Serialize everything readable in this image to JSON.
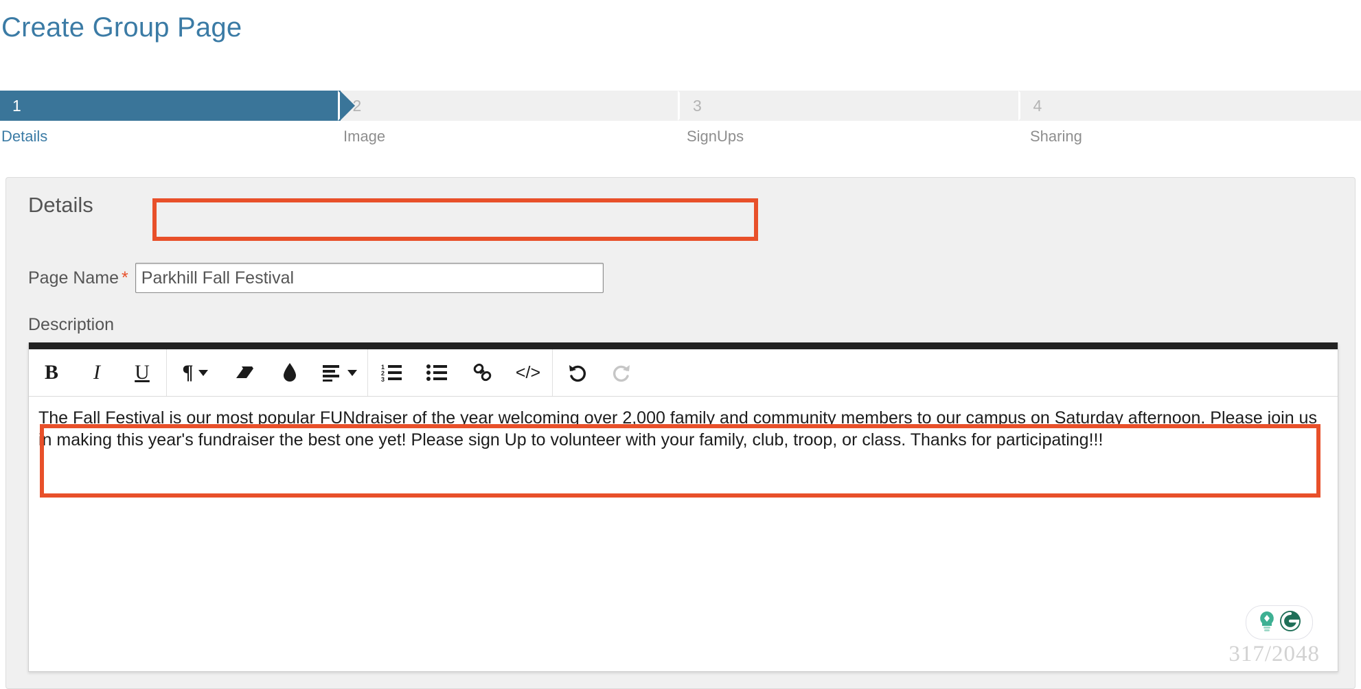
{
  "page": {
    "title": "Create Group Page"
  },
  "wizard": {
    "steps": [
      {
        "number": "1",
        "label": "Details",
        "state": "active"
      },
      {
        "number": "2",
        "label": "Image",
        "state": "inactive"
      },
      {
        "number": "3",
        "label": "SignUps",
        "state": "inactive"
      },
      {
        "number": "4",
        "label": "Sharing",
        "state": "inactive"
      }
    ]
  },
  "details_panel": {
    "heading": "Details",
    "page_name": {
      "label": "Page Name",
      "required_marker": "*",
      "value": "Parkhill Fall Festival",
      "placeholder": ""
    },
    "description": {
      "label": "Description",
      "text": "The Fall Festival is our most popular FUNdraiser of the year welcoming over 2,000 family and community members to our campus on Saturday afternoon. Please join us in making this year's fundraiser the best one yet! Please sign Up to volunteer with your family, club, troop, or class. Thanks for participating!!!",
      "char_counter": "317/2048"
    },
    "toolbar": {
      "buttons": [
        {
          "name": "bold",
          "glyph": "B"
        },
        {
          "name": "italic",
          "glyph": "I"
        },
        {
          "name": "underline",
          "glyph": "U"
        },
        {
          "name": "paragraph-style",
          "glyph": "¶"
        },
        {
          "name": "clear-formatting",
          "glyph": "eraser"
        },
        {
          "name": "text-color",
          "glyph": "droplet"
        },
        {
          "name": "align",
          "glyph": "align-lines"
        },
        {
          "name": "ordered-list",
          "glyph": "123-list"
        },
        {
          "name": "unordered-list",
          "glyph": "bullet-list"
        },
        {
          "name": "insert-link",
          "glyph": "chain-link"
        },
        {
          "name": "code-view",
          "glyph": "</>"
        },
        {
          "name": "undo",
          "glyph": "undo-arrow",
          "state": "enabled"
        },
        {
          "name": "redo",
          "glyph": "redo-arrow",
          "state": "disabled"
        }
      ]
    }
  },
  "colors": {
    "accent_blue": "#3b7ba5",
    "step_active": "#3a7599",
    "step_inactive": "#f0f0f0",
    "annotation_red": "#e8502a",
    "panel_bg": "#f0f0f0",
    "grammarly_green": "#15C39A"
  },
  "grammarly_badge": {
    "name": "grammarly-badge"
  }
}
